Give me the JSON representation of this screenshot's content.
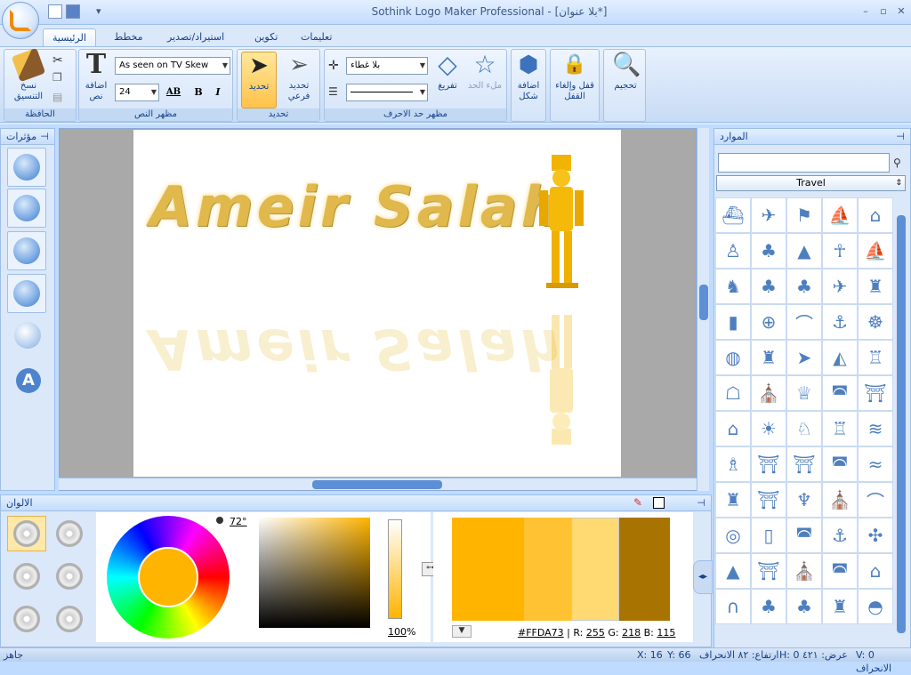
{
  "window": {
    "title": "Sothink Logo Maker Professional - [بلا عنوان*]"
  },
  "tabs": [
    {
      "label": "الرئيسية",
      "active": true
    },
    {
      "label": "مخطط"
    },
    {
      "label": "استيراد/تصدير"
    },
    {
      "label": "تكوين"
    },
    {
      "label": "تعليمات"
    }
  ],
  "groups": {
    "clipboard": {
      "label": "الحافظة",
      "format_painter": "نسخ التنسيق"
    },
    "text": {
      "label": "مظهر النص",
      "add_text": "اضافة نص",
      "font": "As seen on TV Skew",
      "size": "24"
    },
    "select": {
      "label": "تحديد",
      "select": "تحديد",
      "subselect": "تحديد فرعي"
    },
    "border": {
      "label": "مظهر حد الاحرف",
      "no_fill": "بلا غطاء",
      "unfill": "تفريغ",
      "fill": "ملء الحد"
    },
    "shape": {
      "add_shape": "اضافة شكل"
    },
    "lock": {
      "label": "قفل وإلغاء القفل"
    },
    "zoom": {
      "label": "تحجيم"
    }
  },
  "effects_panel": {
    "title": "مؤثرات"
  },
  "resources_panel": {
    "title": "الموارد",
    "category": "Travel",
    "search_value": ""
  },
  "colors_panel": {
    "title": "الالوان",
    "angle": "72°",
    "alpha": "100",
    "alpha_unit": "%",
    "hex": "#FFDA73",
    "r_label": "R:",
    "r": "255",
    "g_label": "G:",
    "g": "218",
    "b_label": "B:",
    "b": "115"
  },
  "swatch_colors": [
    "#ffb400",
    "#ffc233",
    "#ffda73",
    "#a87300"
  ],
  "logo": {
    "text": "Ameir Salah"
  },
  "status": {
    "left": "جاهز",
    "v": "V: 0 الانحراف",
    "h": "H: 0 عرض: ٤٢١",
    "height": "ارتفاع: ٨٢ الانحراف",
    "y": "Y: 66",
    "x": "X: 16"
  }
}
